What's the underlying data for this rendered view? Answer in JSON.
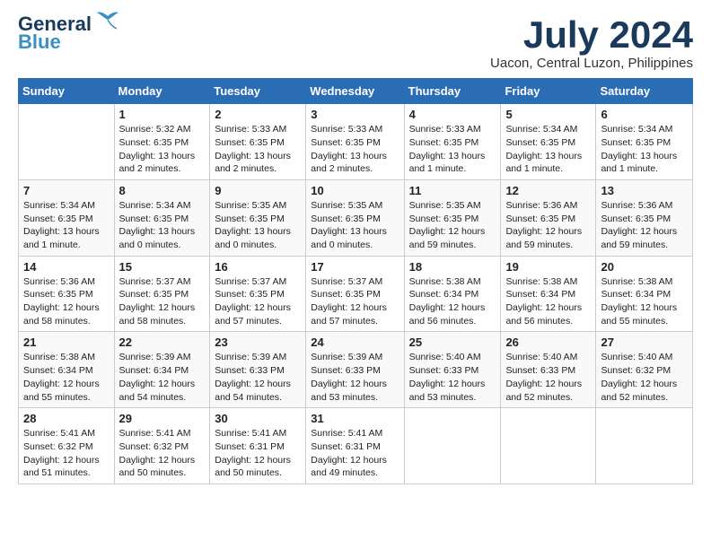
{
  "header": {
    "logo_line1": "General",
    "logo_line2": "Blue",
    "month_year": "July 2024",
    "location": "Uacon, Central Luzon, Philippines"
  },
  "weekdays": [
    "Sunday",
    "Monday",
    "Tuesday",
    "Wednesday",
    "Thursday",
    "Friday",
    "Saturday"
  ],
  "weeks": [
    [
      {
        "day": "",
        "sunrise": "",
        "sunset": "",
        "daylight": ""
      },
      {
        "day": "1",
        "sunrise": "Sunrise: 5:32 AM",
        "sunset": "Sunset: 6:35 PM",
        "daylight": "Daylight: 13 hours and 2 minutes."
      },
      {
        "day": "2",
        "sunrise": "Sunrise: 5:33 AM",
        "sunset": "Sunset: 6:35 PM",
        "daylight": "Daylight: 13 hours and 2 minutes."
      },
      {
        "day": "3",
        "sunrise": "Sunrise: 5:33 AM",
        "sunset": "Sunset: 6:35 PM",
        "daylight": "Daylight: 13 hours and 2 minutes."
      },
      {
        "day": "4",
        "sunrise": "Sunrise: 5:33 AM",
        "sunset": "Sunset: 6:35 PM",
        "daylight": "Daylight: 13 hours and 1 minute."
      },
      {
        "day": "5",
        "sunrise": "Sunrise: 5:34 AM",
        "sunset": "Sunset: 6:35 PM",
        "daylight": "Daylight: 13 hours and 1 minute."
      },
      {
        "day": "6",
        "sunrise": "Sunrise: 5:34 AM",
        "sunset": "Sunset: 6:35 PM",
        "daylight": "Daylight: 13 hours and 1 minute."
      }
    ],
    [
      {
        "day": "7",
        "sunrise": "Sunrise: 5:34 AM",
        "sunset": "Sunset: 6:35 PM",
        "daylight": "Daylight: 13 hours and 1 minute."
      },
      {
        "day": "8",
        "sunrise": "Sunrise: 5:34 AM",
        "sunset": "Sunset: 6:35 PM",
        "daylight": "Daylight: 13 hours and 0 minutes."
      },
      {
        "day": "9",
        "sunrise": "Sunrise: 5:35 AM",
        "sunset": "Sunset: 6:35 PM",
        "daylight": "Daylight: 13 hours and 0 minutes."
      },
      {
        "day": "10",
        "sunrise": "Sunrise: 5:35 AM",
        "sunset": "Sunset: 6:35 PM",
        "daylight": "Daylight: 13 hours and 0 minutes."
      },
      {
        "day": "11",
        "sunrise": "Sunrise: 5:35 AM",
        "sunset": "Sunset: 6:35 PM",
        "daylight": "Daylight: 12 hours and 59 minutes."
      },
      {
        "day": "12",
        "sunrise": "Sunrise: 5:36 AM",
        "sunset": "Sunset: 6:35 PM",
        "daylight": "Daylight: 12 hours and 59 minutes."
      },
      {
        "day": "13",
        "sunrise": "Sunrise: 5:36 AM",
        "sunset": "Sunset: 6:35 PM",
        "daylight": "Daylight: 12 hours and 59 minutes."
      }
    ],
    [
      {
        "day": "14",
        "sunrise": "Sunrise: 5:36 AM",
        "sunset": "Sunset: 6:35 PM",
        "daylight": "Daylight: 12 hours and 58 minutes."
      },
      {
        "day": "15",
        "sunrise": "Sunrise: 5:37 AM",
        "sunset": "Sunset: 6:35 PM",
        "daylight": "Daylight: 12 hours and 58 minutes."
      },
      {
        "day": "16",
        "sunrise": "Sunrise: 5:37 AM",
        "sunset": "Sunset: 6:35 PM",
        "daylight": "Daylight: 12 hours and 57 minutes."
      },
      {
        "day": "17",
        "sunrise": "Sunrise: 5:37 AM",
        "sunset": "Sunset: 6:35 PM",
        "daylight": "Daylight: 12 hours and 57 minutes."
      },
      {
        "day": "18",
        "sunrise": "Sunrise: 5:38 AM",
        "sunset": "Sunset: 6:34 PM",
        "daylight": "Daylight: 12 hours and 56 minutes."
      },
      {
        "day": "19",
        "sunrise": "Sunrise: 5:38 AM",
        "sunset": "Sunset: 6:34 PM",
        "daylight": "Daylight: 12 hours and 56 minutes."
      },
      {
        "day": "20",
        "sunrise": "Sunrise: 5:38 AM",
        "sunset": "Sunset: 6:34 PM",
        "daylight": "Daylight: 12 hours and 55 minutes."
      }
    ],
    [
      {
        "day": "21",
        "sunrise": "Sunrise: 5:38 AM",
        "sunset": "Sunset: 6:34 PM",
        "daylight": "Daylight: 12 hours and 55 minutes."
      },
      {
        "day": "22",
        "sunrise": "Sunrise: 5:39 AM",
        "sunset": "Sunset: 6:34 PM",
        "daylight": "Daylight: 12 hours and 54 minutes."
      },
      {
        "day": "23",
        "sunrise": "Sunrise: 5:39 AM",
        "sunset": "Sunset: 6:33 PM",
        "daylight": "Daylight: 12 hours and 54 minutes."
      },
      {
        "day": "24",
        "sunrise": "Sunrise: 5:39 AM",
        "sunset": "Sunset: 6:33 PM",
        "daylight": "Daylight: 12 hours and 53 minutes."
      },
      {
        "day": "25",
        "sunrise": "Sunrise: 5:40 AM",
        "sunset": "Sunset: 6:33 PM",
        "daylight": "Daylight: 12 hours and 53 minutes."
      },
      {
        "day": "26",
        "sunrise": "Sunrise: 5:40 AM",
        "sunset": "Sunset: 6:33 PM",
        "daylight": "Daylight: 12 hours and 52 minutes."
      },
      {
        "day": "27",
        "sunrise": "Sunrise: 5:40 AM",
        "sunset": "Sunset: 6:32 PM",
        "daylight": "Daylight: 12 hours and 52 minutes."
      }
    ],
    [
      {
        "day": "28",
        "sunrise": "Sunrise: 5:41 AM",
        "sunset": "Sunset: 6:32 PM",
        "daylight": "Daylight: 12 hours and 51 minutes."
      },
      {
        "day": "29",
        "sunrise": "Sunrise: 5:41 AM",
        "sunset": "Sunset: 6:32 PM",
        "daylight": "Daylight: 12 hours and 50 minutes."
      },
      {
        "day": "30",
        "sunrise": "Sunrise: 5:41 AM",
        "sunset": "Sunset: 6:31 PM",
        "daylight": "Daylight: 12 hours and 50 minutes."
      },
      {
        "day": "31",
        "sunrise": "Sunrise: 5:41 AM",
        "sunset": "Sunset: 6:31 PM",
        "daylight": "Daylight: 12 hours and 49 minutes."
      },
      {
        "day": "",
        "sunrise": "",
        "sunset": "",
        "daylight": ""
      },
      {
        "day": "",
        "sunrise": "",
        "sunset": "",
        "daylight": ""
      },
      {
        "day": "",
        "sunrise": "",
        "sunset": "",
        "daylight": ""
      }
    ]
  ]
}
